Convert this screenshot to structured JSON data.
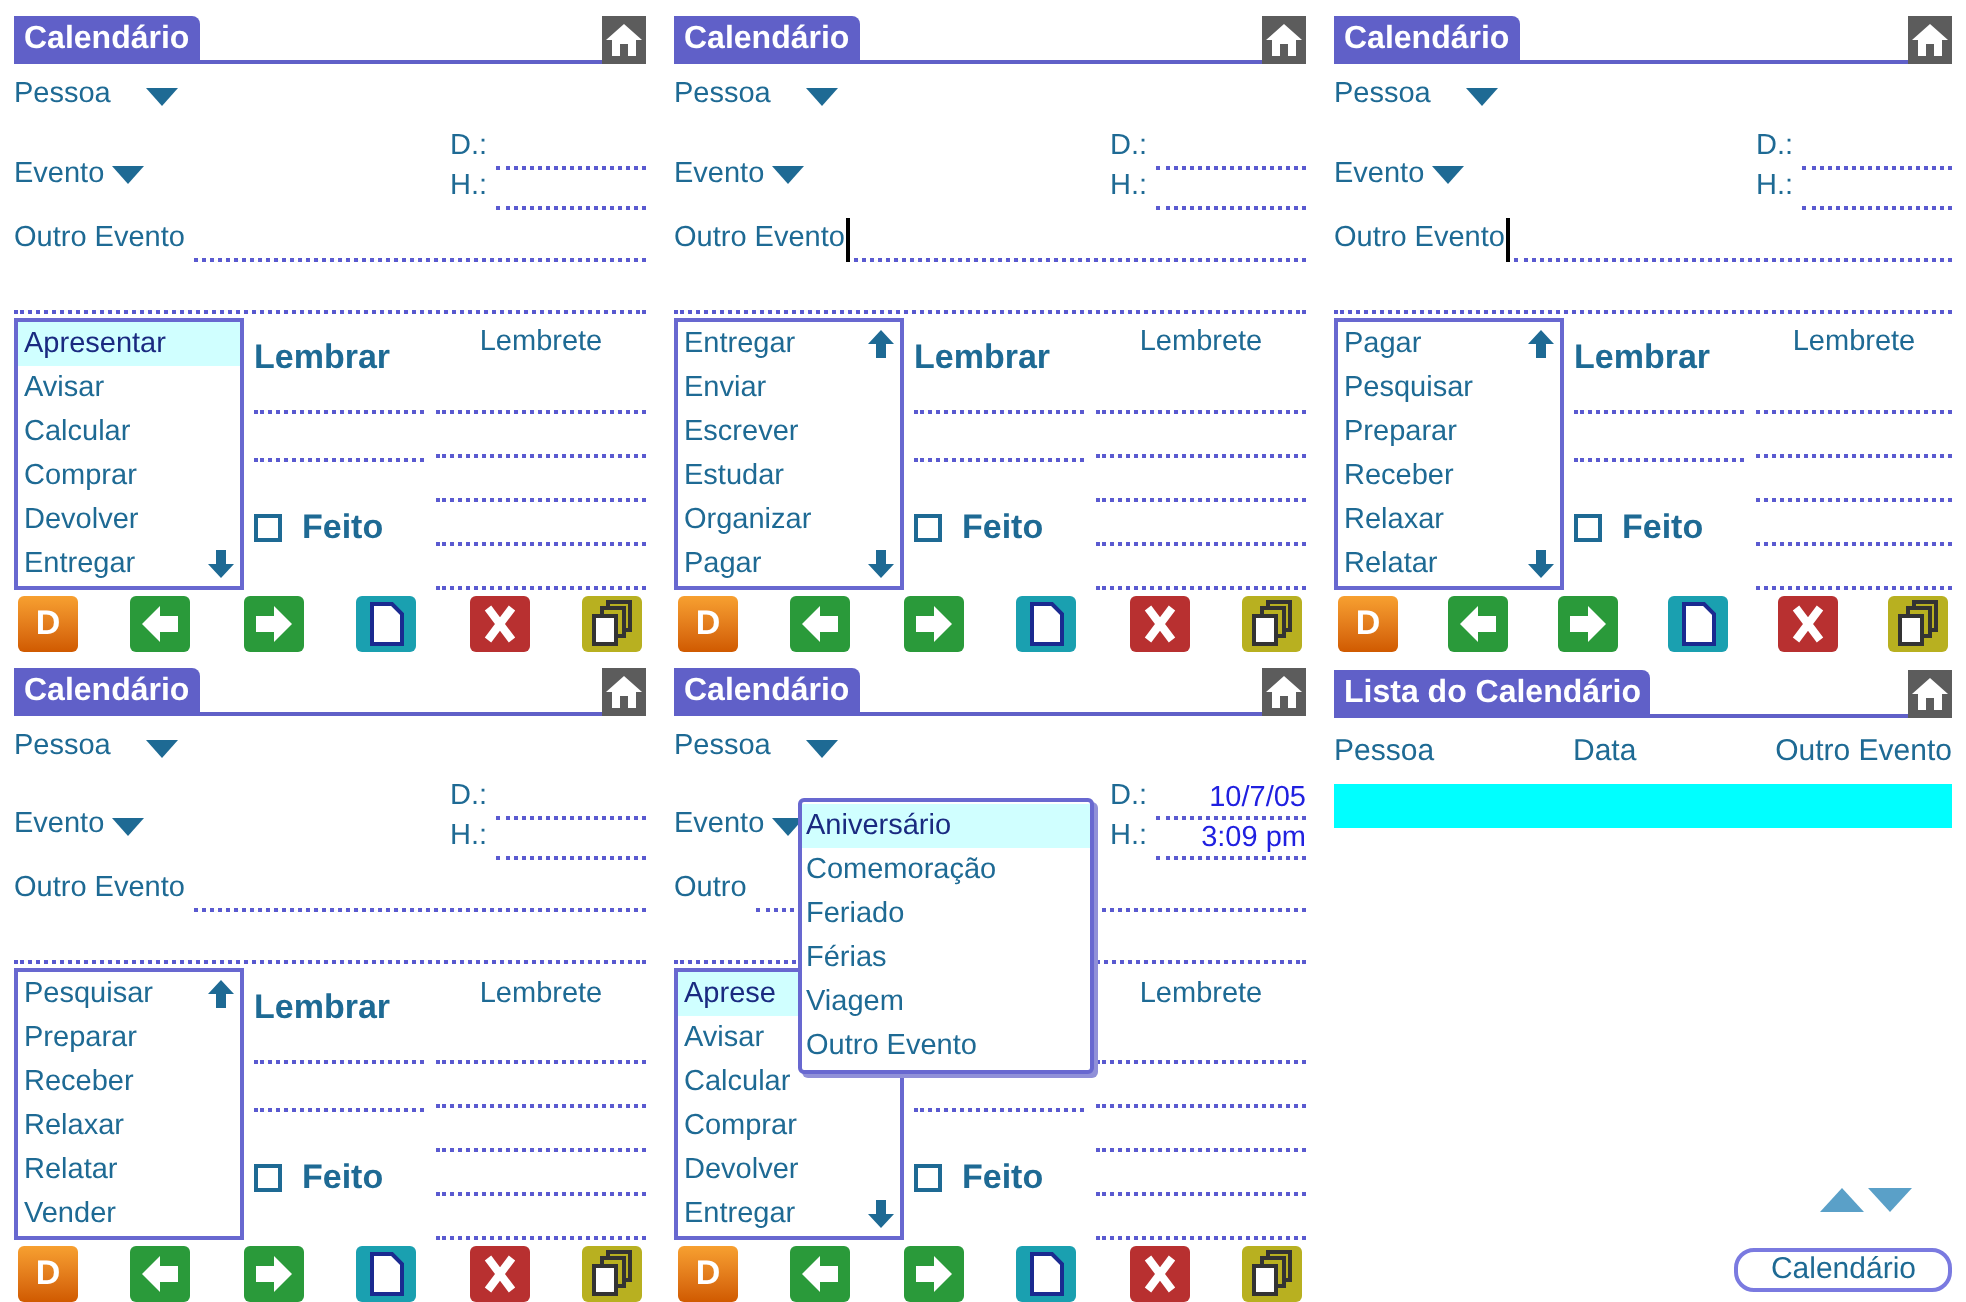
{
  "screens": [
    {
      "kind": "form",
      "title": "Calendário",
      "pessoa": "Pessoa",
      "evento": "Evento",
      "d_label": "D.:",
      "h_label": "H.:",
      "outro": "Outro Evento",
      "cursor": false,
      "list": [
        {
          "label": "Apresentar",
          "selected": true
        },
        {
          "label": "Avisar",
          "selected": false
        },
        {
          "label": "Calcular",
          "selected": false
        },
        {
          "label": "Comprar",
          "selected": false
        },
        {
          "label": "Devolver",
          "selected": false
        },
        {
          "label": "Entregar",
          "selected": false
        }
      ],
      "scroll_up": false,
      "scroll_down": true,
      "lembrar": "Lembrar",
      "feito": {
        "label": "Feito",
        "checked": false
      },
      "lembrete": "Lembrete",
      "toolbar": [
        {
          "kind": "letter",
          "label": "D"
        },
        {
          "kind": "back"
        },
        {
          "kind": "forward"
        },
        {
          "kind": "page"
        },
        {
          "kind": "delete"
        },
        {
          "kind": "copy"
        }
      ]
    },
    {
      "kind": "form",
      "title": "Calendário",
      "pessoa": "Pessoa",
      "evento": "Evento",
      "d_label": "D.:",
      "h_label": "H.:",
      "outro": "Outro Evento",
      "cursor": true,
      "list": [
        {
          "label": "Entregar",
          "selected": false
        },
        {
          "label": "Enviar",
          "selected": false
        },
        {
          "label": "Escrever",
          "selected": false
        },
        {
          "label": "Estudar",
          "selected": false
        },
        {
          "label": "Organizar",
          "selected": false
        },
        {
          "label": "Pagar",
          "selected": false
        }
      ],
      "scroll_up": true,
      "scroll_down": true,
      "lembrar": "Lembrar",
      "feito": {
        "label": "Feito",
        "checked": false
      },
      "lembrete": "Lembrete",
      "toolbar": [
        {
          "kind": "letter",
          "label": "D"
        },
        {
          "kind": "back"
        },
        {
          "kind": "forward"
        },
        {
          "kind": "page"
        },
        {
          "kind": "delete"
        },
        {
          "kind": "copy"
        }
      ]
    },
    {
      "kind": "form",
      "title": "Calendário",
      "pessoa": "Pessoa",
      "evento": "Evento",
      "d_label": "D.:",
      "h_label": "H.:",
      "outro": "Outro Evento",
      "cursor": true,
      "list": [
        {
          "label": "Pagar",
          "selected": false
        },
        {
          "label": "Pesquisar",
          "selected": false
        },
        {
          "label": "Preparar",
          "selected": false
        },
        {
          "label": "Receber",
          "selected": false
        },
        {
          "label": "Relaxar",
          "selected": false
        },
        {
          "label": "Relatar",
          "selected": false
        }
      ],
      "scroll_up": true,
      "scroll_down": true,
      "lembrar": "Lembrar",
      "feito": {
        "label": "Feito",
        "checked": false
      },
      "lembrete": "Lembrete",
      "toolbar": [
        {
          "kind": "letter",
          "label": "D"
        },
        {
          "kind": "back"
        },
        {
          "kind": "forward"
        },
        {
          "kind": "page"
        },
        {
          "kind": "delete"
        },
        {
          "kind": "copy"
        }
      ]
    },
    {
      "kind": "form",
      "title": "Calendário",
      "pessoa": "Pessoa",
      "evento": "Evento",
      "d_label": "D.:",
      "h_label": "H.:",
      "outro": "Outro Evento",
      "cursor": false,
      "list": [
        {
          "label": "Pesquisar",
          "selected": false
        },
        {
          "label": "Preparar",
          "selected": false
        },
        {
          "label": "Receber",
          "selected": false
        },
        {
          "label": "Relaxar",
          "selected": false
        },
        {
          "label": "Relatar",
          "selected": false
        },
        {
          "label": "Vender",
          "selected": false
        }
      ],
      "scroll_up": true,
      "scroll_down": false,
      "lembrar": "Lembrar",
      "feito": {
        "label": "Feito",
        "checked": false
      },
      "lembrete": "Lembrete",
      "toolbar": [
        {
          "kind": "letter",
          "label": "D"
        },
        {
          "kind": "back"
        },
        {
          "kind": "forward"
        },
        {
          "kind": "page"
        },
        {
          "kind": "delete"
        },
        {
          "kind": "copy"
        }
      ]
    },
    {
      "kind": "form",
      "title": "Calendário",
      "pessoa": "Pessoa",
      "evento": "Evento",
      "d_label": "D.:",
      "date": "10/7/05",
      "h_label": "H.:",
      "time": "3:09 pm",
      "outro": "Outro",
      "cursor": false,
      "list": [
        {
          "label": "Aprese",
          "selected": true
        },
        {
          "label": "Avisar",
          "selected": false
        },
        {
          "label": "Calcular",
          "selected": false
        },
        {
          "label": "Comprar",
          "selected": false
        },
        {
          "label": "Devolver",
          "selected": false
        },
        {
          "label": "Entregar",
          "selected": false
        }
      ],
      "scroll_up": false,
      "scroll_down": true,
      "feito": {
        "label": "Feito",
        "checked": false
      },
      "lembrete": "Lembrete",
      "popup": [
        {
          "label": "Aniversário",
          "selected": true
        },
        {
          "label": "Comemoração",
          "selected": false
        },
        {
          "label": "Feriado",
          "selected": false
        },
        {
          "label": "Férias",
          "selected": false
        },
        {
          "label": "Viagem",
          "selected": false
        },
        {
          "label": "Outro Evento",
          "selected": false
        }
      ],
      "toolbar": [
        {
          "kind": "letter",
          "label": "D"
        },
        {
          "kind": "back"
        },
        {
          "kind": "forward"
        },
        {
          "kind": "page"
        },
        {
          "kind": "delete"
        },
        {
          "kind": "copy"
        }
      ]
    },
    {
      "kind": "list",
      "title": "Lista do Calendário",
      "columns": [
        "Pessoa",
        "Data",
        "Outro Evento"
      ],
      "rows": [
        {
          "selected": true
        }
      ],
      "button": "Calendário"
    }
  ]
}
